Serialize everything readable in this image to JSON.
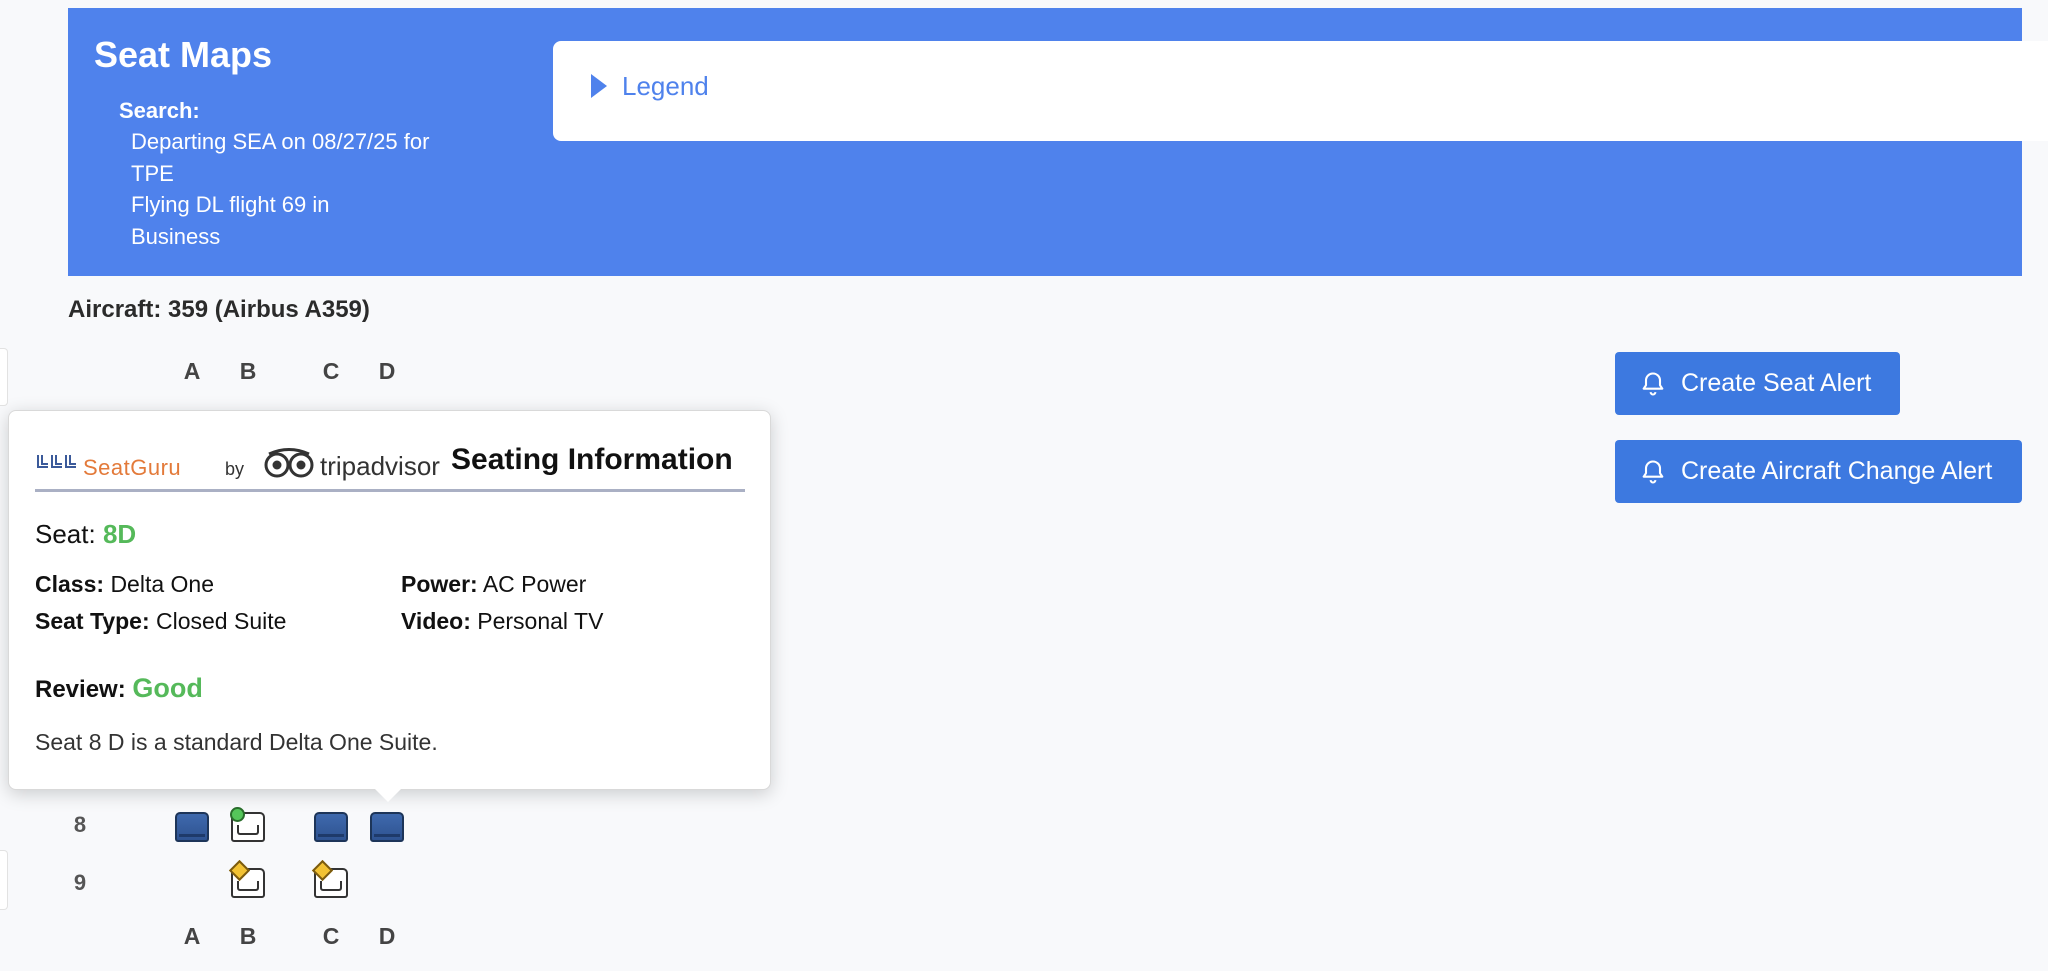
{
  "header": {
    "title": "Seat Maps",
    "search_label": "Search:",
    "search_lines": [
      "Departing SEA on 08/27/25 for",
      "TPE",
      "Flying DL flight 69 in",
      "Business"
    ]
  },
  "legend": {
    "label": "Legend"
  },
  "aircraft": {
    "label": "Aircraft: 359 (Airbus A359)"
  },
  "seatmap": {
    "top_letters": [
      "A",
      "B",
      "C",
      "D"
    ],
    "bottom_letters": [
      "A",
      "B",
      "C",
      "D"
    ],
    "rows": [
      {
        "number": "8",
        "seats": [
          "occupied",
          "open-green",
          "occupied",
          "occupied"
        ]
      },
      {
        "number": "9",
        "seats": [
          "empty",
          "open-yellow",
          "open-yellow",
          "empty"
        ]
      }
    ]
  },
  "buttons": {
    "seat_alert": "Create Seat Alert",
    "aircraft_change_alert": "Create Aircraft Change Alert"
  },
  "tooltip": {
    "brand": {
      "seatguru": "SeatGuru",
      "by": "by",
      "tripadvisor": "tripadvisor"
    },
    "title": "Seating Information",
    "seat_label": "Seat:",
    "seat_value": "8D",
    "class_label": "Class:",
    "class_value": "Delta One",
    "seat_type_label": "Seat Type:",
    "seat_type_value": "Closed Suite",
    "power_label": "Power:",
    "power_value": "AC Power",
    "video_label": "Video:",
    "video_value": "Personal TV",
    "review_label": "Review:",
    "review_value": "Good",
    "description": "Seat 8 D is a standard Delta One Suite."
  },
  "colors": {
    "header_bg": "#4f82ec",
    "button_bg": "#3d79e0",
    "good_green": "#55b95a",
    "seat_occupied": "#3f69ad"
  }
}
